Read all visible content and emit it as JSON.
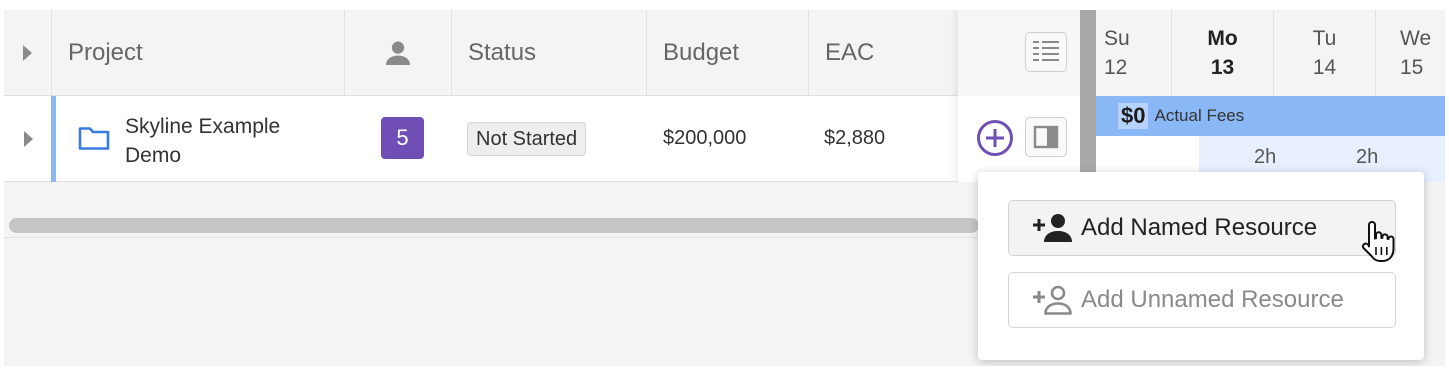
{
  "grid": {
    "columns": {
      "project": "Project",
      "status": "Status",
      "budget": "Budget",
      "eac": "EAC"
    },
    "row": {
      "project_name": "Skyline Example Demo",
      "resource_count": "5",
      "status": "Not Started",
      "budget": "$200,000",
      "eac": "$2,880"
    }
  },
  "calendar": {
    "days": [
      {
        "weekday": "Su",
        "date": "12"
      },
      {
        "weekday": "Mo",
        "date": "13"
      },
      {
        "weekday": "Tu",
        "date": "14"
      },
      {
        "weekday": "We",
        "date": "15"
      }
    ],
    "fees_amount": "$0",
    "fees_label": "Actual Fees",
    "hours": [
      "2h",
      "2h"
    ]
  },
  "menu": {
    "add_named": "Add Named Resource",
    "add_unnamed": "Add Unnamed Resource"
  },
  "colors": {
    "accent_purple": "#6f4fb5",
    "folder_blue": "#3a7be0",
    "fee_bar_blue": "#8ab8f6",
    "row_accent": "#8bb7ee"
  },
  "icons": {
    "expand": "caret-right-icon",
    "person": "person-icon",
    "folder": "folder-icon",
    "list_view": "list-view-icon",
    "add": "plus-circle-icon",
    "panel": "side-panel-icon",
    "add_person": "add-person-icon",
    "add_person_outline": "add-person-outline-icon",
    "cursor": "hand-cursor-icon"
  }
}
